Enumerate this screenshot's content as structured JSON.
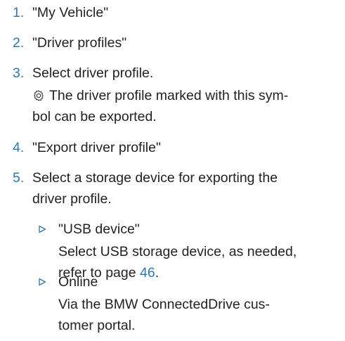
{
  "steps": [
    {
      "num": "1.",
      "text": "\"My Vehicle\""
    },
    {
      "num": "2.",
      "text": "\"Driver profiles\""
    },
    {
      "num": "3.",
      "text": "Select driver profile.",
      "note_line1": "The driver profile marked with this sym-",
      "note_line2": "bol can be exported.",
      "note_icon": "gear-icon"
    },
    {
      "num": "4.",
      "text": "\"Export driver profile\""
    },
    {
      "num": "5.",
      "text_line1": "Select a storage device for exporting the",
      "text_line2": "driver profile."
    }
  ],
  "options": [
    {
      "bullet_icon": "triangle-bullet-icon",
      "label": "\"USB device\"",
      "desc_line1": "Select USB storage device, as needed,",
      "desc_line2_prefix": "refer to page ",
      "page_link": "46",
      "desc_line2_suffix": "."
    },
    {
      "bullet_icon": "triangle-bullet-icon",
      "label": "Online",
      "desc_line1": "Via the BMW ConnectedDrive cus-",
      "desc_line2": "tomer portal."
    }
  ],
  "colors": {
    "accent": "#2a79b8",
    "text": "#222222"
  }
}
